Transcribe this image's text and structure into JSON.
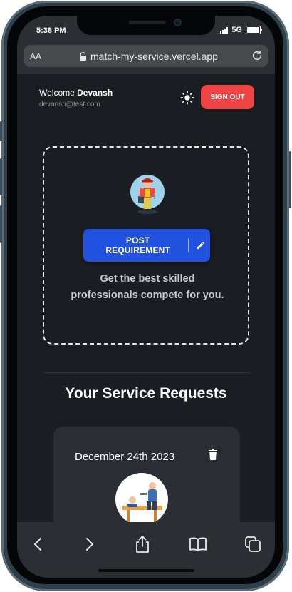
{
  "status_bar": {
    "time": "5:38 PM",
    "network": "5G"
  },
  "browser": {
    "aa_label": "AA",
    "url": "match-my-service.vercel.app"
  },
  "header": {
    "welcome_prefix": "Welcome ",
    "user_name": "Devansh",
    "email": "devansh@test.com",
    "sign_out_label": "SIGN OUT",
    "theme_icon": "sun-icon"
  },
  "post_card": {
    "button_label": "POST REQUIREMENT",
    "button_icon": "pencil-icon",
    "description": "Get the best skilled professionals compete for you."
  },
  "requests": {
    "title": "Your Service Requests",
    "items": [
      {
        "date": "December 24th 2023"
      }
    ]
  },
  "toolbar": {
    "icons": [
      "back-icon",
      "forward-icon",
      "share-icon",
      "bookmarks-icon",
      "tabs-icon"
    ]
  },
  "colors": {
    "page_bg": "#1a1d21",
    "accent_blue": "#2051df",
    "danger_red": "#ef4444",
    "card_bg": "#2a2d33"
  }
}
